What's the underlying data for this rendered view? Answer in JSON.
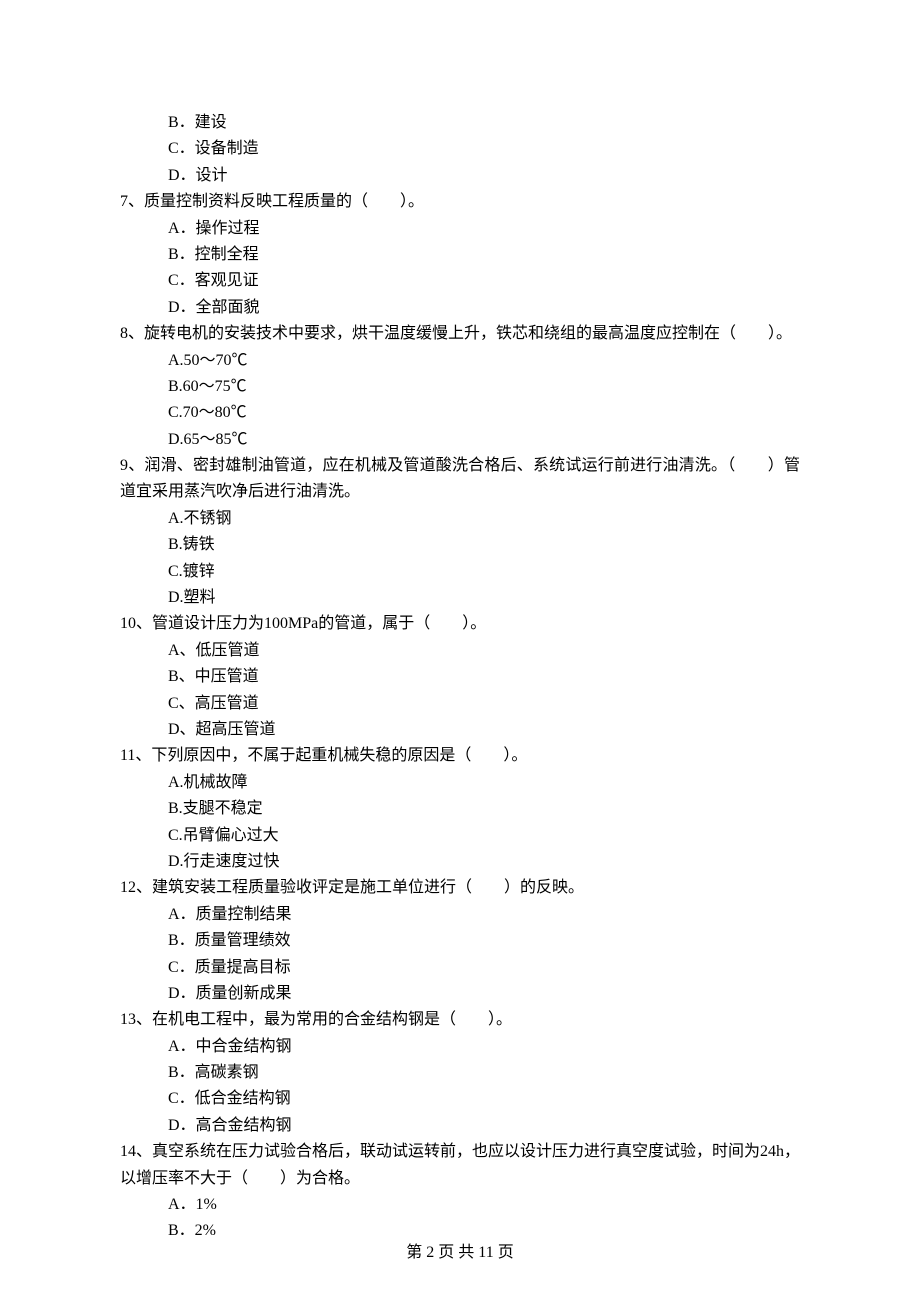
{
  "carryover_options": {
    "b": "B．建设",
    "c": "C．设备制造",
    "d": "D．设计"
  },
  "questions": [
    {
      "stem": "7、质量控制资料反映工程质量的（　　）。",
      "options": [
        "A．操作过程",
        "B．控制全程",
        "C．客观见证",
        "D．全部面貌"
      ]
    },
    {
      "stem": "8、旋转电机的安装技术中要求，烘干温度缓慢上升，铁芯和绕组的最高温度应控制在（　　）。",
      "options": [
        "A.50～70℃",
        "B.60～75℃",
        "C.70～80℃",
        "D.65～85℃"
      ]
    },
    {
      "stem": "9、润滑、密封雄制油管道，应在机械及管道酸洗合格后、系统试运行前进行油清洗。（　　）管道宜采用蒸汽吹净后进行油清洗。",
      "options": [
        "A.不锈钢",
        "B.铸铁",
        "C.镀锌",
        "D.塑料"
      ]
    },
    {
      "stem": "10、管道设计压力为100MPa的管道，属于（　　）。",
      "options": [
        "A、低压管道",
        "B、中压管道",
        "C、高压管道",
        "D、超高压管道"
      ]
    },
    {
      "stem": "11、下列原因中，不属于起重机械失稳的原因是（　　）。",
      "options": [
        "A.机械故障",
        "B.支腿不稳定",
        "C.吊臂偏心过大",
        "D.行走速度过快"
      ]
    },
    {
      "stem": "12、建筑安装工程质量验收评定是施工单位进行（　　）的反映。",
      "options": [
        "A．质量控制结果",
        "B．质量管理绩效",
        "C．质量提高目标",
        "D．质量创新成果"
      ]
    },
    {
      "stem": "13、在机电工程中，最为常用的合金结构钢是（　　）。",
      "options": [
        "A．中合金结构钢",
        "B．高碳素钢",
        "C．低合金结构钢",
        "D．高合金结构钢"
      ]
    },
    {
      "stem": "14、真空系统在压力试验合格后，联动试运转前，也应以设计压力进行真空度试验，时间为24h，以增压率不大于（　　）为合格。",
      "options": [
        "A．1%",
        "B．2%"
      ]
    }
  ],
  "footer": "第 2 页 共 11 页"
}
